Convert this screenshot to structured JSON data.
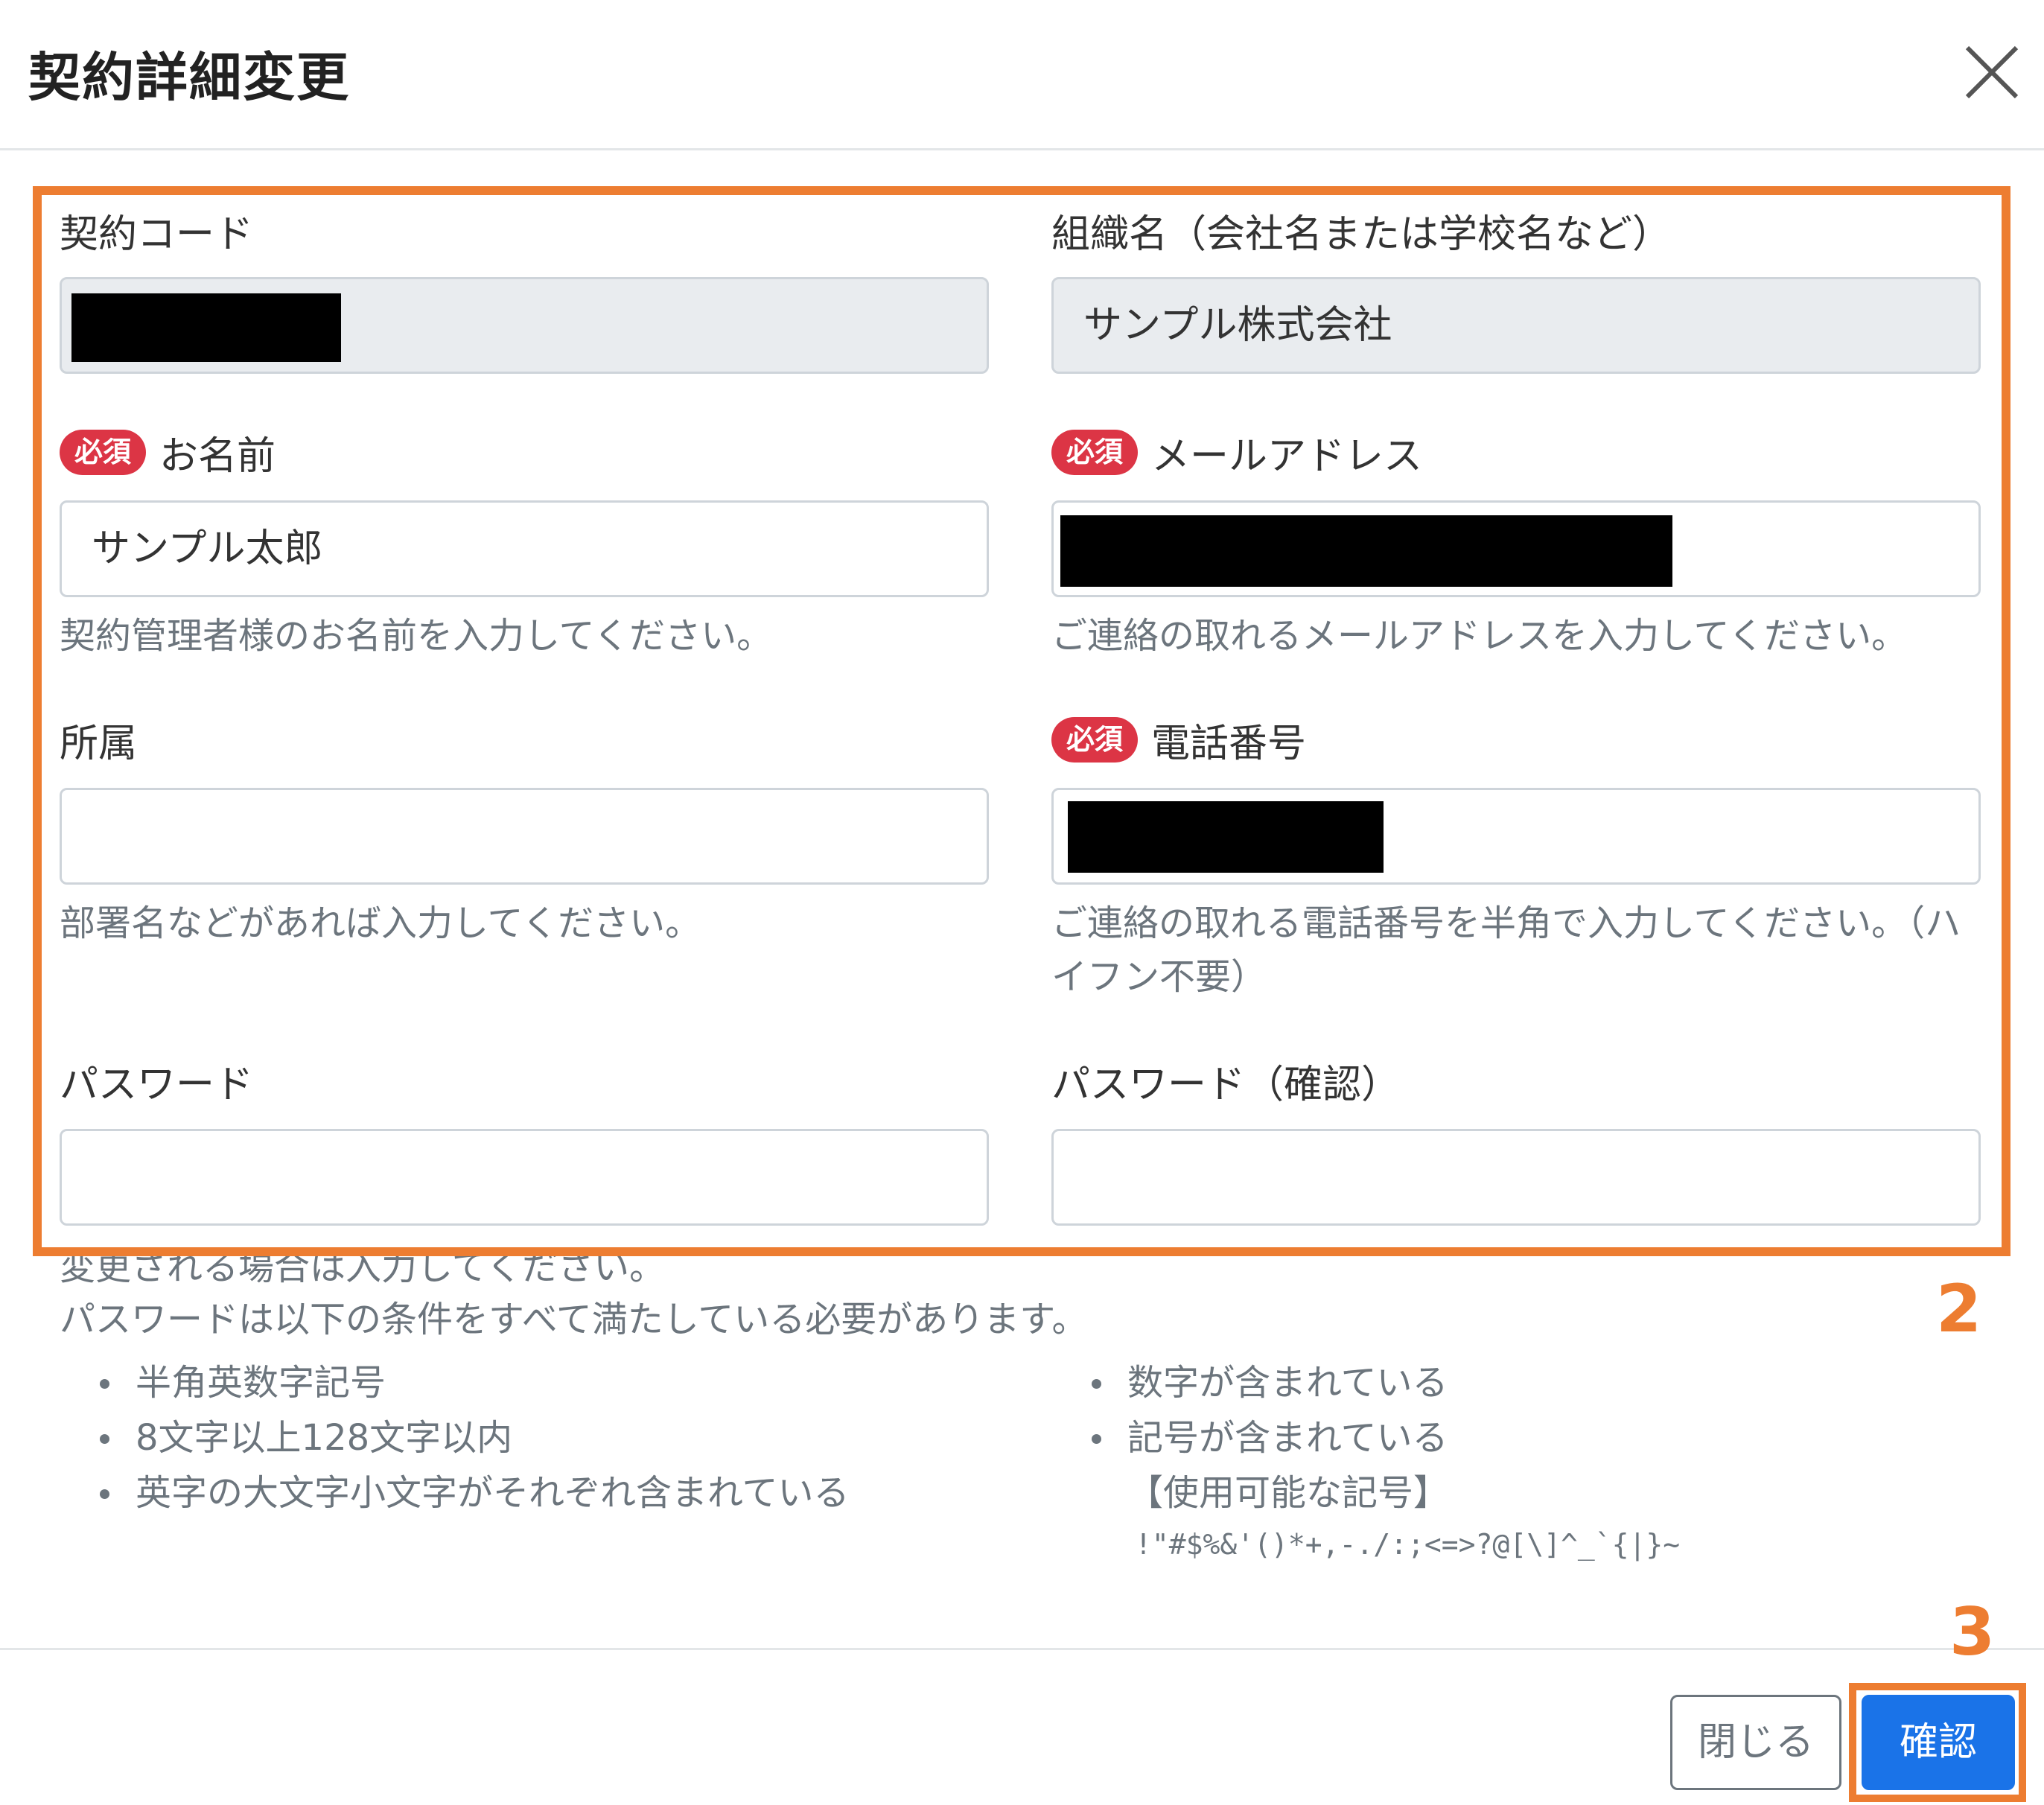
{
  "dialog": {
    "title": "契約詳細変更",
    "close_icon": "close-icon"
  },
  "form": {
    "contract_code": {
      "label": "契約コード",
      "value": ""
    },
    "organization": {
      "label": "組織名（会社名または学校名など）",
      "value": "サンプル株式会社"
    },
    "name": {
      "badge": "必須",
      "label": "お名前",
      "value": "サンプル太郎",
      "help": "契約管理者様のお名前を入力してください。"
    },
    "email": {
      "badge": "必須",
      "label": "メールアドレス",
      "value": "",
      "help": "ご連絡の取れるメールアドレスを入力してください。"
    },
    "department": {
      "label": "所属",
      "value": "",
      "help": "部署名などがあれば入力してください。"
    },
    "phone": {
      "badge": "必須",
      "label": "電話番号",
      "value": "",
      "help": "ご連絡の取れる電話番号を半角で入力してください。（ハイフン不要）"
    },
    "password": {
      "label": "パスワード",
      "value": ""
    },
    "password_confirm": {
      "label": "パスワード（確認）",
      "value": ""
    }
  },
  "password_help": {
    "line1": "変更される場合は入力してください。",
    "line2": "パスワードは以下の条件をすべて満たしている必要があります。",
    "left_rules": [
      "半角英数字記号",
      "8文字以上128文字以内",
      "英字の大文字小文字がそれぞれ含まれている"
    ],
    "right_rules": [
      "数字が含まれている",
      "記号が含まれている"
    ],
    "symbols_title": "【使用可能な記号】",
    "symbols": "!\"#$%&'()*+,-./:;<=>?@[\\]^_`{|}~"
  },
  "annotations": {
    "step2": "2",
    "step3": "3"
  },
  "footer": {
    "close_label": "閉じる",
    "confirm_label": "確認"
  },
  "colors": {
    "highlight": "#ed7d31",
    "primary": "#1a73e8",
    "required": "#dc3545",
    "readonly_bg": "#e9ecef"
  }
}
